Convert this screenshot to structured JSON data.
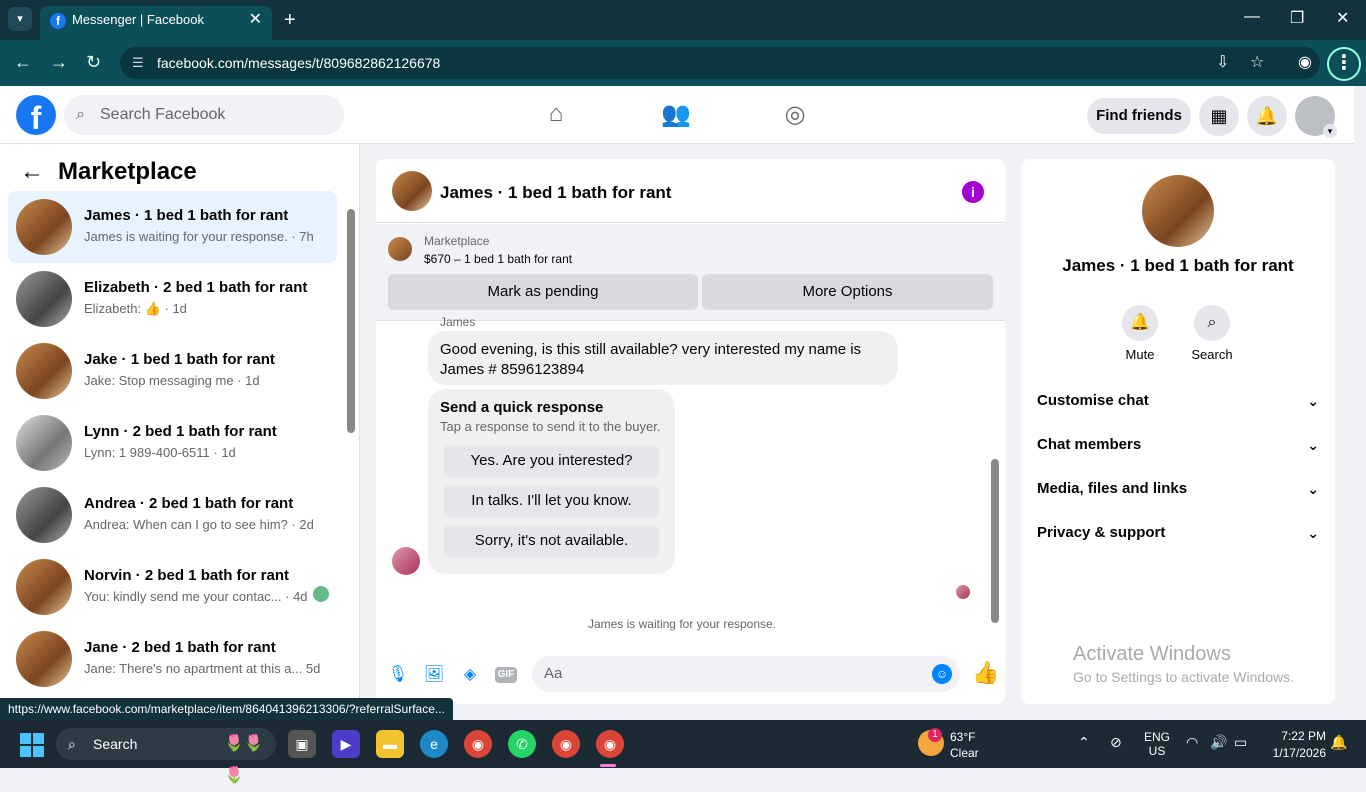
{
  "browser": {
    "tab_title": "Messenger | Facebook",
    "url": "facebook.com/messages/t/809682862126678",
    "status_url": "https://www.facebook.com/marketplace/item/864041396213306/?referralSurface..."
  },
  "fb": {
    "search_placeholder": "Search Facebook",
    "find_friends": "Find friends"
  },
  "sidebar": {
    "title": "Marketplace",
    "conversations": [
      {
        "name": "James · 1 bed 1 bath for rant",
        "preview": "James is waiting for your response. · 7h"
      },
      {
        "name": "Elizabeth · 2 bed 1 bath for rant",
        "preview": "Elizabeth: 👍 · 1d"
      },
      {
        "name": "Jake · 1 bed 1 bath for rant",
        "preview": "Jake: Stop messaging me · 1d"
      },
      {
        "name": "Lynn · 2 bed 1 bath for rant",
        "preview": "Lynn: 1 989-400-6511 · 1d"
      },
      {
        "name": "Andrea · 2 bed 1 bath for rant",
        "preview": "Andrea: When can I go to see him? · 2d"
      },
      {
        "name": "Norvin · 2 bed 1 bath for rant",
        "preview": "You: kindly send me your contac... · 4d"
      },
      {
        "name": "Jane · 2 bed 1 bath for rant",
        "preview": "Jane: There's no apartment at this a... 5d"
      }
    ]
  },
  "chat": {
    "title": "James · 1 bed 1 bath for rant",
    "marketplace_label": "Marketplace",
    "listing": "$670 – 1 bed 1 bath for rant",
    "mark_pending": "Mark as pending",
    "more_options": "More Options",
    "author": "James",
    "message": "Good evening, is this still available? very interested my name is James # 8596123894",
    "quick_title": "Send a quick response",
    "quick_sub": "Tap a response to send it to the buyer.",
    "quick_options": [
      "Yes. Are you interested?",
      "In talks. I'll let you know.",
      "Sorry, it's not available."
    ],
    "waiting": "James is waiting for your response.",
    "composer_placeholder": "Aa"
  },
  "details": {
    "name": "James · 1 bed 1 bath for rant",
    "mute": "Mute",
    "search": "Search",
    "sections": [
      "Customise chat",
      "Chat members",
      "Media, files and links",
      "Privacy & support"
    ]
  },
  "watermark": {
    "title": "Activate Windows",
    "sub": "Go to Settings to activate Windows."
  },
  "taskbar": {
    "search": "Search",
    "weather_temp": "63°F",
    "weather_cond": "Clear",
    "weather_badge": "1",
    "lang1": "ENG",
    "lang2": "US",
    "time": "7:22 PM",
    "date": "1/17/2026"
  }
}
